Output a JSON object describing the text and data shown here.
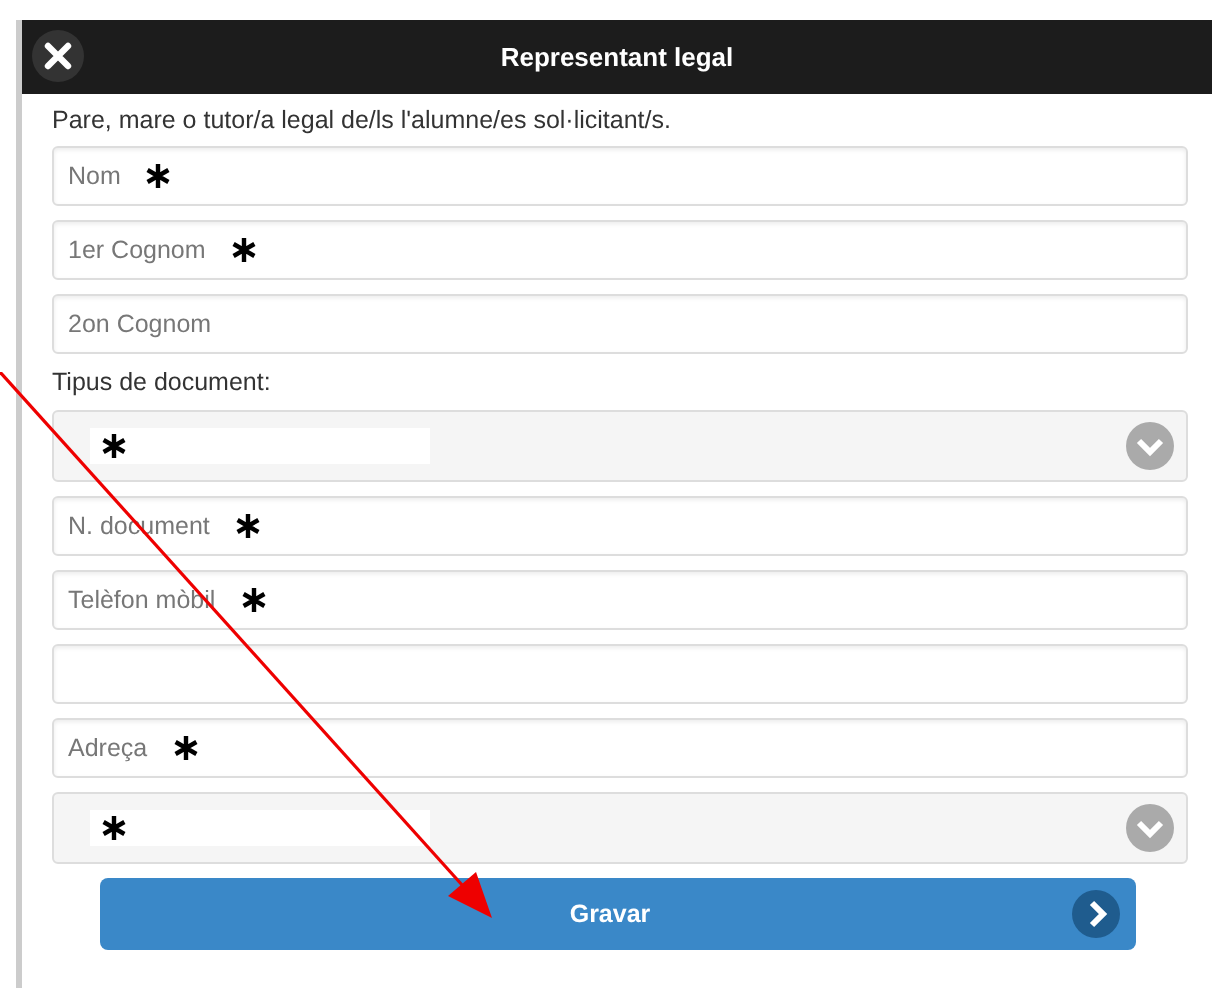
{
  "dialog": {
    "title": "Representant legal"
  },
  "intro": "Pare, mare o tutor/a legal de/ls l'alumne/es sol·licitant/s.",
  "fields": [
    {
      "kind": "text",
      "placeholder": "Nom",
      "required": true
    },
    {
      "kind": "text",
      "placeholder": "1er Cognom",
      "required": true
    },
    {
      "kind": "text",
      "placeholder": "2on Cognom",
      "required": false
    },
    {
      "kind": "label",
      "label": "Tipus de document:"
    },
    {
      "kind": "select",
      "required": true
    },
    {
      "kind": "text",
      "placeholder": "N. document",
      "required": true
    },
    {
      "kind": "text",
      "placeholder": "Telèfon mòbil",
      "required": true
    },
    {
      "kind": "text",
      "required": false
    },
    {
      "kind": "text",
      "placeholder": "Adreça",
      "required": true
    },
    {
      "kind": "select",
      "required": true
    }
  ],
  "save_button": {
    "label": "Gravar"
  },
  "annotation": {
    "kind": "arrow"
  }
}
